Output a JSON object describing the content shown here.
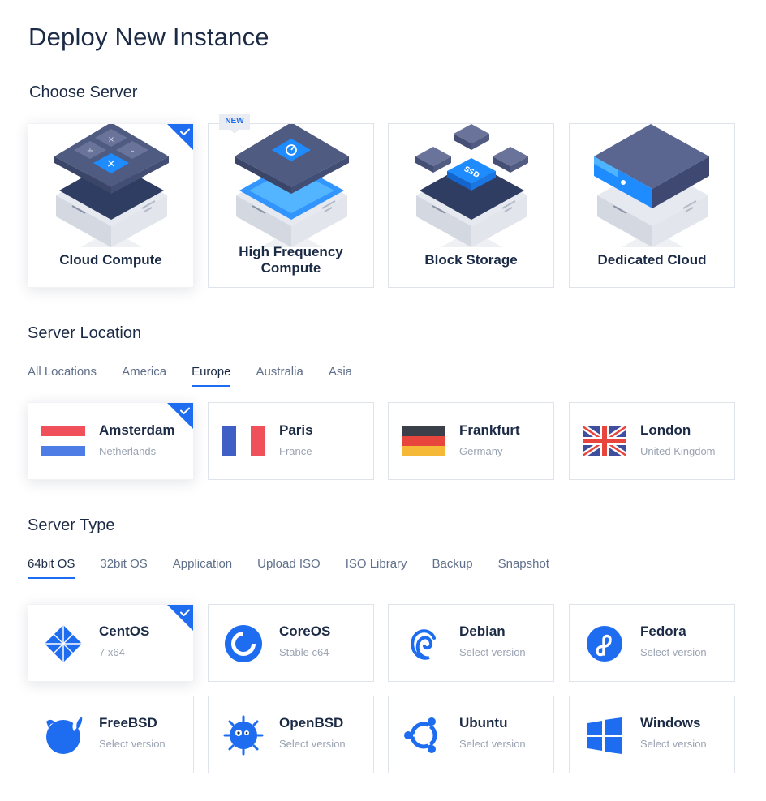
{
  "page": {
    "title": "Deploy New Instance"
  },
  "colors": {
    "accent": "#1e6cf0",
    "text": "#1c2b45",
    "muted": "#9aa3b2",
    "border": "#dfe3ea"
  },
  "server": {
    "title": "Choose Server",
    "new_badge": "NEW",
    "options": [
      {
        "label": "Cloud Compute",
        "icon": "calculator-server-icon",
        "selected": true
      },
      {
        "label": "High Frequency Compute",
        "icon": "speed-server-icon",
        "selected": false,
        "badge": "NEW"
      },
      {
        "label": "Block Storage",
        "icon": "ssd-storage-icon",
        "selected": false
      },
      {
        "label": "Dedicated Cloud",
        "icon": "dedicated-server-icon",
        "selected": false
      }
    ]
  },
  "location": {
    "title": "Server Location",
    "tabs": [
      "All Locations",
      "America",
      "Europe",
      "Australia",
      "Asia"
    ],
    "active_tab": "Europe",
    "options": [
      {
        "name": "Amsterdam",
        "country": "Netherlands",
        "flag": "netherlands-flag-icon",
        "selected": true
      },
      {
        "name": "Paris",
        "country": "France",
        "flag": "france-flag-icon",
        "selected": false
      },
      {
        "name": "Frankfurt",
        "country": "Germany",
        "flag": "germany-flag-icon",
        "selected": false
      },
      {
        "name": "London",
        "country": "United Kingdom",
        "flag": "uk-flag-icon",
        "selected": false
      }
    ]
  },
  "type": {
    "title": "Server Type",
    "tabs": [
      "64bit OS",
      "32bit OS",
      "Application",
      "Upload ISO",
      "ISO Library",
      "Backup",
      "Snapshot"
    ],
    "active_tab": "64bit OS",
    "options": [
      {
        "name": "CentOS",
        "version": "7 x64",
        "icon": "centos-icon",
        "selected": true
      },
      {
        "name": "CoreOS",
        "version": "Stable c64",
        "icon": "coreos-icon",
        "selected": false
      },
      {
        "name": "Debian",
        "version": "Select version",
        "icon": "debian-icon",
        "selected": false
      },
      {
        "name": "Fedora",
        "version": "Select version",
        "icon": "fedora-icon",
        "selected": false
      },
      {
        "name": "FreeBSD",
        "version": "Select version",
        "icon": "freebsd-icon",
        "selected": false
      },
      {
        "name": "OpenBSD",
        "version": "Select version",
        "icon": "openbsd-icon",
        "selected": false
      },
      {
        "name": "Ubuntu",
        "version": "Select version",
        "icon": "ubuntu-icon",
        "selected": false
      },
      {
        "name": "Windows",
        "version": "Select version",
        "icon": "windows-icon",
        "selected": false
      }
    ]
  }
}
